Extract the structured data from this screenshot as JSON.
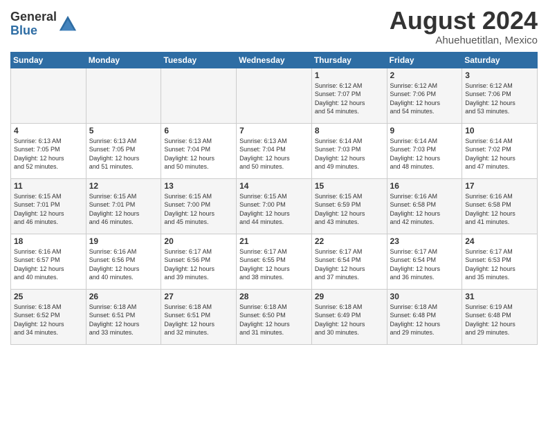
{
  "logo": {
    "general": "General",
    "blue": "Blue"
  },
  "title": "August 2024",
  "location": "Ahuehuetitlan, Mexico",
  "days_of_week": [
    "Sunday",
    "Monday",
    "Tuesday",
    "Wednesday",
    "Thursday",
    "Friday",
    "Saturday"
  ],
  "weeks": [
    {
      "days": [
        {
          "num": "",
          "info": ""
        },
        {
          "num": "",
          "info": ""
        },
        {
          "num": "",
          "info": ""
        },
        {
          "num": "",
          "info": ""
        },
        {
          "num": "1",
          "info": "Sunrise: 6:12 AM\nSunset: 7:07 PM\nDaylight: 12 hours\nand 54 minutes."
        },
        {
          "num": "2",
          "info": "Sunrise: 6:12 AM\nSunset: 7:06 PM\nDaylight: 12 hours\nand 54 minutes."
        },
        {
          "num": "3",
          "info": "Sunrise: 6:12 AM\nSunset: 7:06 PM\nDaylight: 12 hours\nand 53 minutes."
        }
      ]
    },
    {
      "days": [
        {
          "num": "4",
          "info": "Sunrise: 6:13 AM\nSunset: 7:05 PM\nDaylight: 12 hours\nand 52 minutes."
        },
        {
          "num": "5",
          "info": "Sunrise: 6:13 AM\nSunset: 7:05 PM\nDaylight: 12 hours\nand 51 minutes."
        },
        {
          "num": "6",
          "info": "Sunrise: 6:13 AM\nSunset: 7:04 PM\nDaylight: 12 hours\nand 50 minutes."
        },
        {
          "num": "7",
          "info": "Sunrise: 6:13 AM\nSunset: 7:04 PM\nDaylight: 12 hours\nand 50 minutes."
        },
        {
          "num": "8",
          "info": "Sunrise: 6:14 AM\nSunset: 7:03 PM\nDaylight: 12 hours\nand 49 minutes."
        },
        {
          "num": "9",
          "info": "Sunrise: 6:14 AM\nSunset: 7:03 PM\nDaylight: 12 hours\nand 48 minutes."
        },
        {
          "num": "10",
          "info": "Sunrise: 6:14 AM\nSunset: 7:02 PM\nDaylight: 12 hours\nand 47 minutes."
        }
      ]
    },
    {
      "days": [
        {
          "num": "11",
          "info": "Sunrise: 6:15 AM\nSunset: 7:01 PM\nDaylight: 12 hours\nand 46 minutes."
        },
        {
          "num": "12",
          "info": "Sunrise: 6:15 AM\nSunset: 7:01 PM\nDaylight: 12 hours\nand 46 minutes."
        },
        {
          "num": "13",
          "info": "Sunrise: 6:15 AM\nSunset: 7:00 PM\nDaylight: 12 hours\nand 45 minutes."
        },
        {
          "num": "14",
          "info": "Sunrise: 6:15 AM\nSunset: 7:00 PM\nDaylight: 12 hours\nand 44 minutes."
        },
        {
          "num": "15",
          "info": "Sunrise: 6:15 AM\nSunset: 6:59 PM\nDaylight: 12 hours\nand 43 minutes."
        },
        {
          "num": "16",
          "info": "Sunrise: 6:16 AM\nSunset: 6:58 PM\nDaylight: 12 hours\nand 42 minutes."
        },
        {
          "num": "17",
          "info": "Sunrise: 6:16 AM\nSunset: 6:58 PM\nDaylight: 12 hours\nand 41 minutes."
        }
      ]
    },
    {
      "days": [
        {
          "num": "18",
          "info": "Sunrise: 6:16 AM\nSunset: 6:57 PM\nDaylight: 12 hours\nand 40 minutes."
        },
        {
          "num": "19",
          "info": "Sunrise: 6:16 AM\nSunset: 6:56 PM\nDaylight: 12 hours\nand 40 minutes."
        },
        {
          "num": "20",
          "info": "Sunrise: 6:17 AM\nSunset: 6:56 PM\nDaylight: 12 hours\nand 39 minutes."
        },
        {
          "num": "21",
          "info": "Sunrise: 6:17 AM\nSunset: 6:55 PM\nDaylight: 12 hours\nand 38 minutes."
        },
        {
          "num": "22",
          "info": "Sunrise: 6:17 AM\nSunset: 6:54 PM\nDaylight: 12 hours\nand 37 minutes."
        },
        {
          "num": "23",
          "info": "Sunrise: 6:17 AM\nSunset: 6:54 PM\nDaylight: 12 hours\nand 36 minutes."
        },
        {
          "num": "24",
          "info": "Sunrise: 6:17 AM\nSunset: 6:53 PM\nDaylight: 12 hours\nand 35 minutes."
        }
      ]
    },
    {
      "days": [
        {
          "num": "25",
          "info": "Sunrise: 6:18 AM\nSunset: 6:52 PM\nDaylight: 12 hours\nand 34 minutes."
        },
        {
          "num": "26",
          "info": "Sunrise: 6:18 AM\nSunset: 6:51 PM\nDaylight: 12 hours\nand 33 minutes."
        },
        {
          "num": "27",
          "info": "Sunrise: 6:18 AM\nSunset: 6:51 PM\nDaylight: 12 hours\nand 32 minutes."
        },
        {
          "num": "28",
          "info": "Sunrise: 6:18 AM\nSunset: 6:50 PM\nDaylight: 12 hours\nand 31 minutes."
        },
        {
          "num": "29",
          "info": "Sunrise: 6:18 AM\nSunset: 6:49 PM\nDaylight: 12 hours\nand 30 minutes."
        },
        {
          "num": "30",
          "info": "Sunrise: 6:18 AM\nSunset: 6:48 PM\nDaylight: 12 hours\nand 29 minutes."
        },
        {
          "num": "31",
          "info": "Sunrise: 6:19 AM\nSunset: 6:48 PM\nDaylight: 12 hours\nand 29 minutes."
        }
      ]
    }
  ]
}
